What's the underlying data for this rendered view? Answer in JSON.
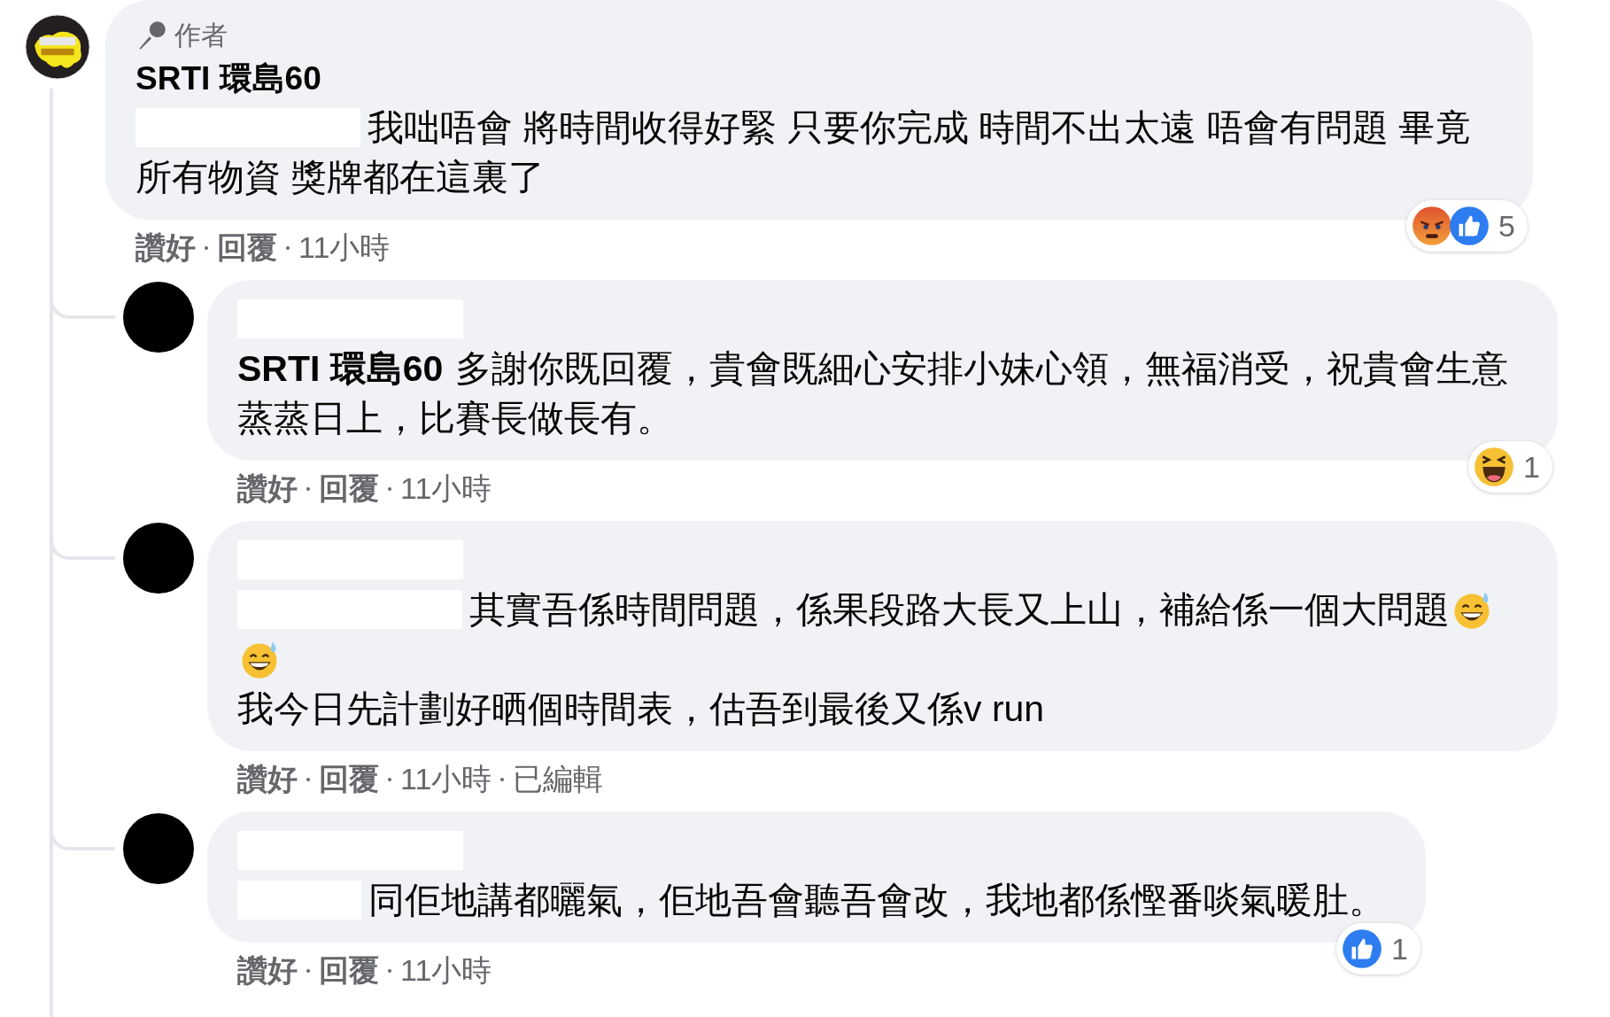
{
  "comments": [
    {
      "avatar": {
        "kind": "logo"
      },
      "author_badge": "作者",
      "name": "SRTI 環島60",
      "paragraphs": [
        [
          {
            "kind": "redaction_long"
          },
          {
            "kind": "text",
            "text": "我咄唔會 將時間收得好緊 只要你完成 時間不出太遠 唔會有問題 畢竟"
          }
        ],
        [
          {
            "kind": "text",
            "text": "所有物資 獎牌都在這裏了"
          }
        ]
      ],
      "reactions": {
        "icons": [
          {
            "kind": "angry"
          },
          {
            "kind": "like"
          }
        ],
        "count": "5"
      },
      "like_label": "讚好",
      "reply_label": "回覆",
      "time": "11小時"
    },
    {
      "avatar": {
        "kind": "plain"
      },
      "name_redacted": true,
      "paragraphs": [
        [
          {
            "kind": "text",
            "mention": "SRTI 環島60",
            "text": "多謝你既回覆，貴會既細心安排小妹心領，無福消受，祝貴會生意蒸蒸日上，比賽長做長有。"
          }
        ]
      ],
      "reactions": {
        "icons": [
          {
            "kind": "laugh"
          }
        ],
        "count": "1"
      },
      "like_label": "讚好",
      "reply_label": "回覆",
      "time": "11小時"
    },
    {
      "avatar": {
        "kind": "plain"
      },
      "name_redacted": true,
      "paragraphs": [
        [
          {
            "kind": "redaction_long"
          },
          {
            "kind": "text",
            "text": "其實吾係時間問題，係果段路大長又上山，補給係一個大問題"
          },
          {
            "kind": "emoji"
          },
          {
            "kind": "emoji"
          }
        ],
        [
          {
            "kind": "text",
            "text": "我今日先計劃好晒個時間表，估吾到最後又係v run"
          }
        ]
      ],
      "like_label": "讚好",
      "reply_label": "回覆",
      "time": "11小時",
      "edited": "已編輯"
    },
    {
      "avatar": {
        "kind": "plain"
      },
      "name_redacted": true,
      "paragraphs": [
        [
          {
            "kind": "redaction_short"
          },
          {
            "kind": "text",
            "text": "同佢地講都曬氣，佢地吾會聽吾會改，我地都係慳番啖氣暖肚。"
          }
        ]
      ],
      "reactions": {
        "icons": [
          {
            "kind": "like"
          }
        ],
        "count": "1"
      },
      "like_label": "讚好",
      "reply_label": "回覆",
      "time": "11小時"
    }
  ]
}
